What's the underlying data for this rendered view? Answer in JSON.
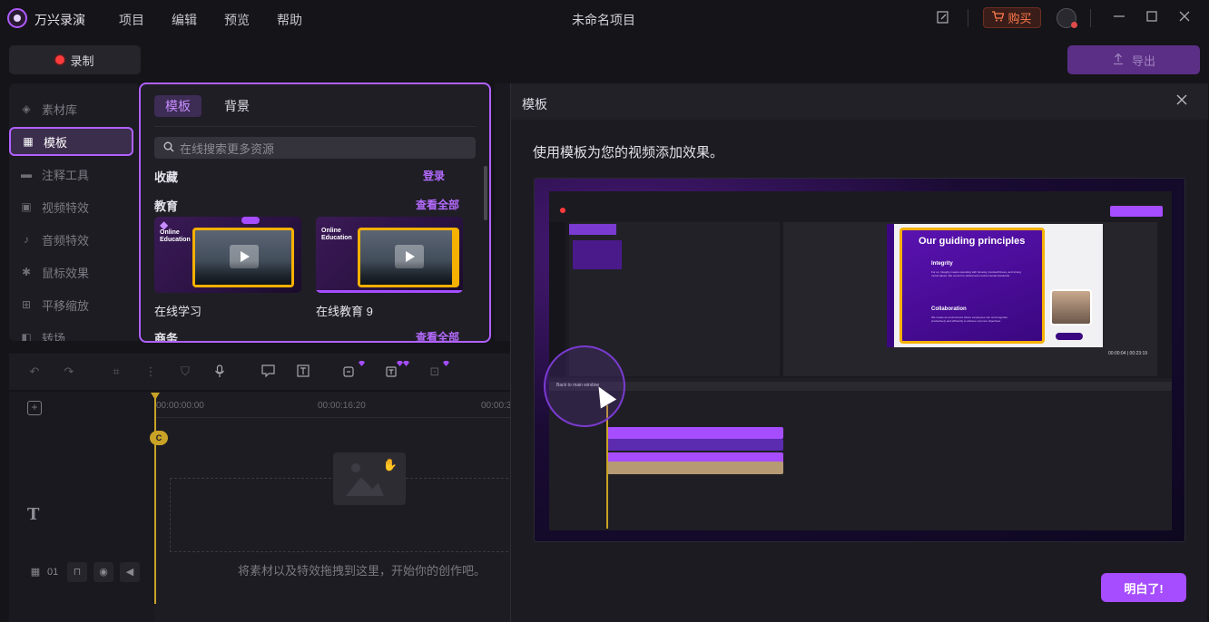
{
  "titlebar": {
    "app_name": "万兴录演",
    "menus": [
      "项目",
      "编辑",
      "预览",
      "帮助"
    ],
    "doc_title": "未命名项目",
    "buy_label": "购买"
  },
  "toolbar": {
    "record_label": "录制",
    "export_label": "导出"
  },
  "sidebar": {
    "items": [
      {
        "label": "素材库",
        "icon": "layers-icon"
      },
      {
        "label": "模板",
        "icon": "template-icon",
        "active": true
      },
      {
        "label": "注释工具",
        "icon": "annotation-icon"
      },
      {
        "label": "视频特效",
        "icon": "video-effects-icon"
      },
      {
        "label": "音频特效",
        "icon": "audio-effects-icon"
      },
      {
        "label": "鼠标效果",
        "icon": "cursor-effects-icon"
      },
      {
        "label": "平移缩放",
        "icon": "pan-zoom-icon"
      },
      {
        "label": "转场",
        "icon": "transition-icon"
      }
    ]
  },
  "templates": {
    "tabs": [
      "模板",
      "背景"
    ],
    "search_placeholder": "在线搜索更多资源",
    "favorites": {
      "title": "收藏",
      "link": "登录"
    },
    "education": {
      "title": "教育",
      "link": "查看全部"
    },
    "business": {
      "title": "商务",
      "link": "查看全部"
    },
    "cards": [
      {
        "label": "在线学习",
        "thumb_text": "Online Education"
      },
      {
        "label": "在线教育 9",
        "thumb_text": "Online Education"
      }
    ]
  },
  "timeline": {
    "times": [
      "00:00:00:00",
      "00:00:16:20",
      "00:00:3"
    ],
    "drop_hint": "将素材以及特效拖拽到这里，开始你的创作吧。",
    "track_number": "01"
  },
  "modal": {
    "title": "模板",
    "description": "使用模板为您的视频添加效果。",
    "confirm_label": "明白了!",
    "preview": {
      "slide_title": "Our guiding principles",
      "items": [
        {
          "title": "Integrity",
          "text": "For us, integrity means operating with honesty, trustworthiness, and strong moral values. We commit to ethical and environmental standards."
        },
        {
          "title": "Collaboration",
          "text": "We create an environment where employees can work together productively and efficiently to achieve common objectives."
        }
      ],
      "back_label": "Back to main window",
      "timecode": "00:00:04 | 00:23:19"
    }
  },
  "colors": {
    "accent": "#a64dff",
    "record": "#ff3b3b",
    "buy": "#ff7a4d",
    "playhead": "#c9a227"
  }
}
